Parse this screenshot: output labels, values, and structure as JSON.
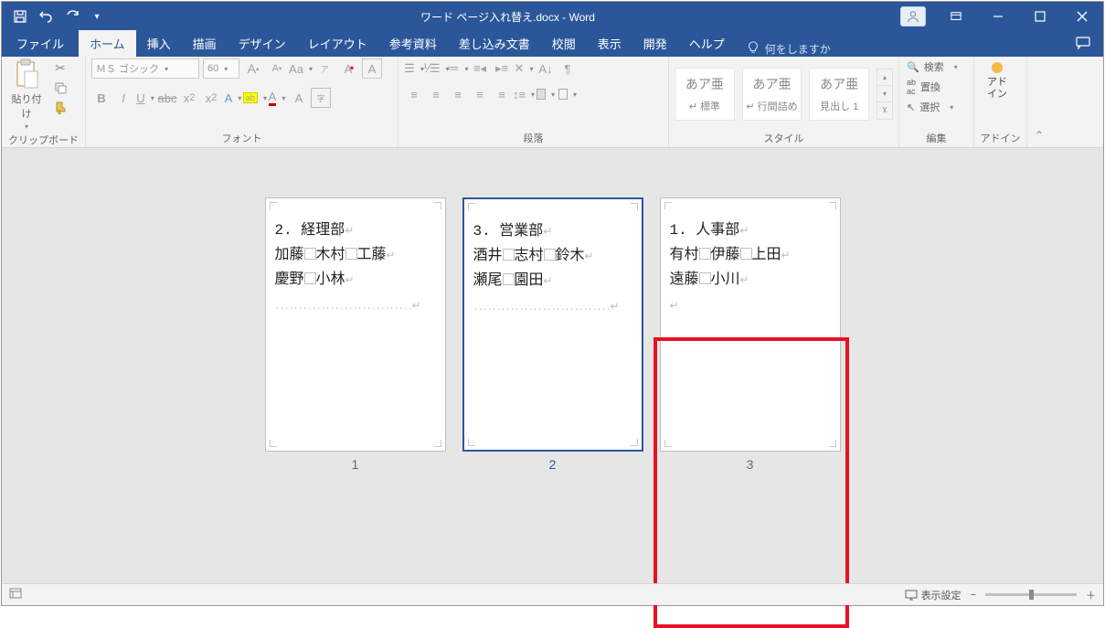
{
  "titlebar": {
    "title": "ワード ページ入れ替え.docx  -  Word"
  },
  "tabs": {
    "file": "ファイル",
    "home": "ホーム",
    "insert": "挿入",
    "draw": "描画",
    "design": "デザイン",
    "layout": "レイアウト",
    "references": "参考資料",
    "mailings": "差し込み文書",
    "review": "校閲",
    "view": "表示",
    "developer": "開発",
    "help": "ヘルプ",
    "tellme": "何をしますか"
  },
  "ribbon": {
    "clipboard": {
      "label": "クリップボード",
      "paste": "貼り付け"
    },
    "font": {
      "label": "フォント",
      "name": "ＭＳ ゴシック",
      "size": "60"
    },
    "paragraph": {
      "label": "段落"
    },
    "styles": {
      "label": "スタイル",
      "items": [
        {
          "preview": "あア亜",
          "name": "↵ 標準"
        },
        {
          "preview": "あア亜",
          "name": "↵ 行間詰め"
        },
        {
          "preview": "あア亜",
          "name": "見出し 1"
        }
      ]
    },
    "editing": {
      "label": "編集",
      "find": "検索",
      "replace": "置換",
      "select": "選択"
    },
    "addins": {
      "label": "アドイン",
      "name": "アド\nイン"
    }
  },
  "pages": [
    {
      "number": "1",
      "heading": "2. 経理部",
      "line2": [
        "加藤",
        "木村",
        "工藤"
      ],
      "line3": [
        "慶野",
        "小林"
      ]
    },
    {
      "number": "2",
      "heading": "3. 営業部",
      "line2": [
        "酒井",
        "志村",
        "鈴木"
      ],
      "line3": [
        "瀬尾",
        "園田"
      ],
      "selected": true
    },
    {
      "number": "3",
      "heading": "1. 人事部",
      "line2": [
        "有村",
        "伊藤",
        "上田"
      ],
      "line3": [
        "遠藤",
        "小川"
      ],
      "highlighted": true
    }
  ],
  "statusbar": {
    "display_settings": "表示設定"
  }
}
